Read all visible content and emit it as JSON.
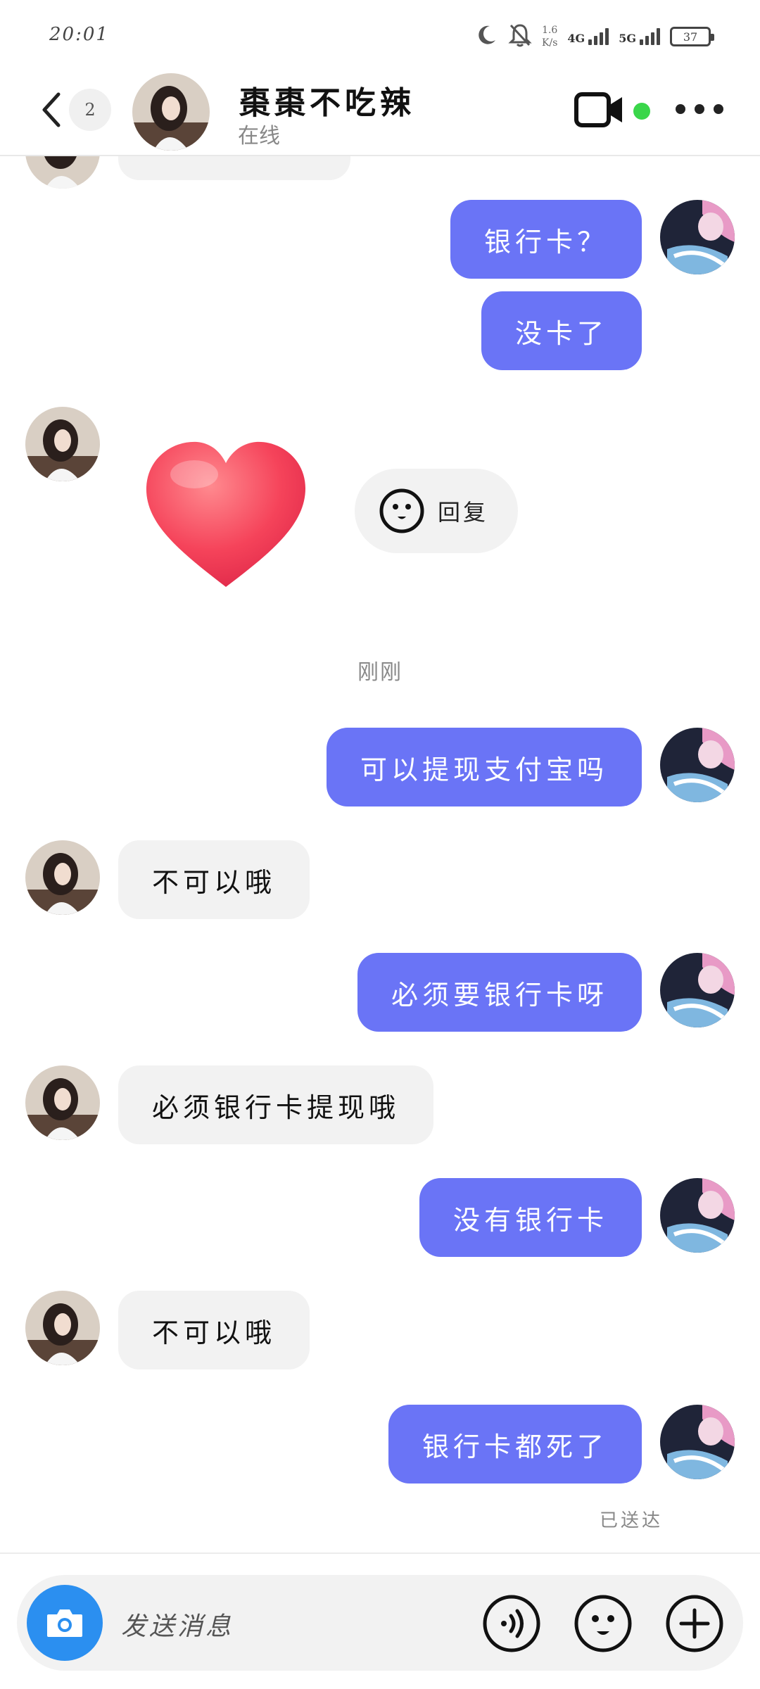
{
  "status_bar": {
    "time": "20:01",
    "net_speed_value": "1.6",
    "net_speed_unit": "K/s",
    "sim1_label": "4G",
    "sim2_label": "5G",
    "battery": "37",
    "icons": [
      "moon-icon",
      "mute-bell-icon"
    ]
  },
  "header": {
    "unread_count": "2",
    "contact_name": "棗棗不吃辣",
    "contact_status": "在线",
    "online": true,
    "icons": [
      "back-arrow-icon",
      "video-call-icon",
      "more-icon"
    ]
  },
  "messages": [
    {
      "direction": "out",
      "text": "银行卡？"
    },
    {
      "direction": "out",
      "text": "没卡了"
    },
    {
      "direction": "in",
      "type": "sticker",
      "sticker": "heart"
    },
    {
      "direction": "out",
      "text": "可以提现支付宝吗"
    },
    {
      "direction": "in",
      "text": "不可以哦"
    },
    {
      "direction": "out",
      "text": "必须要银行卡呀"
    },
    {
      "direction": "in",
      "text": "必须银行卡提现哦"
    },
    {
      "direction": "out",
      "text": "没有银行卡"
    },
    {
      "direction": "in",
      "text": "不可以哦"
    },
    {
      "direction": "out",
      "text": "银行卡都死了"
    }
  ],
  "reply_label": "回复",
  "time_separator": "刚刚",
  "read_receipt": "已送达",
  "input": {
    "placeholder": "发送消息",
    "icons": [
      "camera-icon",
      "voice-icon",
      "emoji-icon",
      "plus-icon"
    ]
  },
  "colors": {
    "outgoing_bubble": "#6a74f6",
    "incoming_bubble": "#f2f2f2",
    "online_dot": "#3ad64a",
    "camera_button": "#2b8ff0"
  }
}
